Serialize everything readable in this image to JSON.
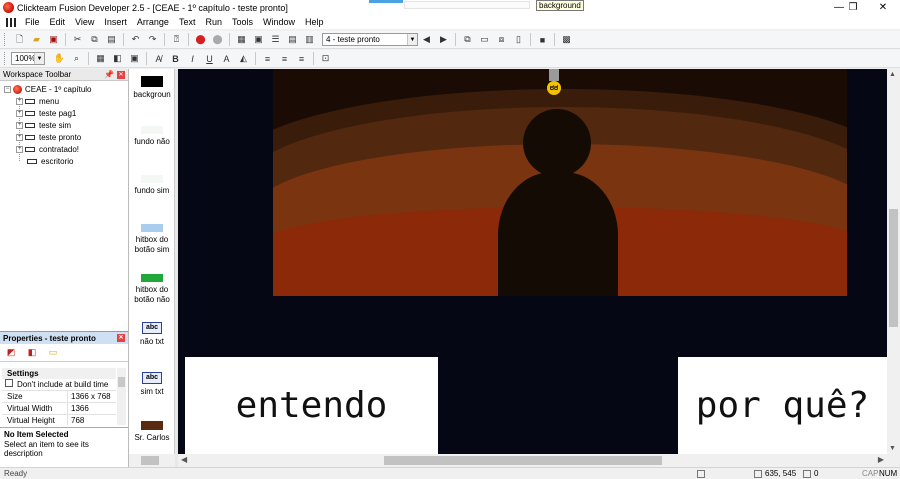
{
  "window": {
    "title": "Clickteam Fusion Developer 2.5 - [CEAE - 1º capítulo - teste pronto]",
    "tooltip": "background",
    "controls": {
      "minimize": "—",
      "restore": "❐",
      "close": "✕"
    }
  },
  "menu": [
    "File",
    "Edit",
    "View",
    "Insert",
    "Arrange",
    "Text",
    "Run",
    "Tools",
    "Window",
    "Help"
  ],
  "toolbar": {
    "frame_select": "4 - teste pronto",
    "zoom": "100%"
  },
  "workspace": {
    "title": "Workspace Toolbar",
    "root": "CEAE - 1º capítulo",
    "frames": [
      "menu",
      "teste pag1",
      "teste sim",
      "teste pronto",
      "contratado!",
      "escritorio"
    ]
  },
  "properties": {
    "title": "Properties - teste pronto",
    "section": "Settings",
    "checkbox_label": "Don't include at build time",
    "rows": [
      {
        "key": "Size",
        "value": "1366 x 768"
      },
      {
        "key": "Virtual Width",
        "value": "1366"
      },
      {
        "key": "Virtual Height",
        "value": "768"
      }
    ],
    "desc_title": "No Item Selected",
    "desc_text": "Select an item to see its description"
  },
  "objects": [
    {
      "label": "backgroun",
      "color": "#000000"
    },
    {
      "label": "fundo não",
      "color": "#f3f8f4"
    },
    {
      "label": "fundo sim",
      "color": "#f3f8f4"
    },
    {
      "label": "hitbox do botão  sim",
      "color": "#a9cdef"
    },
    {
      "label": "hitbox do botão não",
      "color": "#22a83a"
    },
    {
      "label": "não txt",
      "color": "text-icon"
    },
    {
      "label": "sim txt",
      "color": "text-icon"
    },
    {
      "label": "Sr. Carlos",
      "color": "#3a1c0a"
    }
  ],
  "objects_icon_text": "abc",
  "scene": {
    "bubble_left": "entendo",
    "bubble_right": "por quê?",
    "lamp_face": "ಠಠ"
  },
  "status": {
    "left": "Ready",
    "coords": "635, 545",
    "pointer": "0",
    "caps": "CAP",
    "num": "NUM"
  }
}
